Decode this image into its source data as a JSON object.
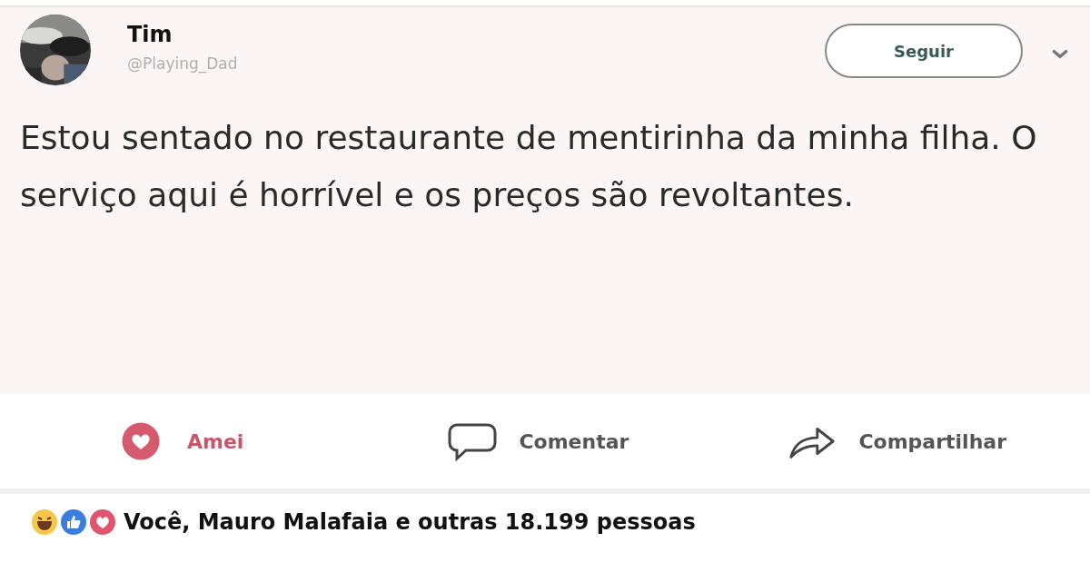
{
  "tweet": {
    "name": "Tim",
    "handle": "@Playing_Dad",
    "follow_button": "Seguir",
    "text": "Estou sentado no restaurante de mentirinha da minha filha. O serviço aqui é horrível e os preços são revoltantes."
  },
  "actions": [
    {
      "kind": "love",
      "label": "Amei",
      "selected": true
    },
    {
      "kind": "comment",
      "label": "Comentar",
      "selected": false
    },
    {
      "kind": "share",
      "label": "Compartilhar",
      "selected": false
    }
  ],
  "reactions_summary": "Você, Mauro Malafaia e outras 18.199 pessoas"
}
